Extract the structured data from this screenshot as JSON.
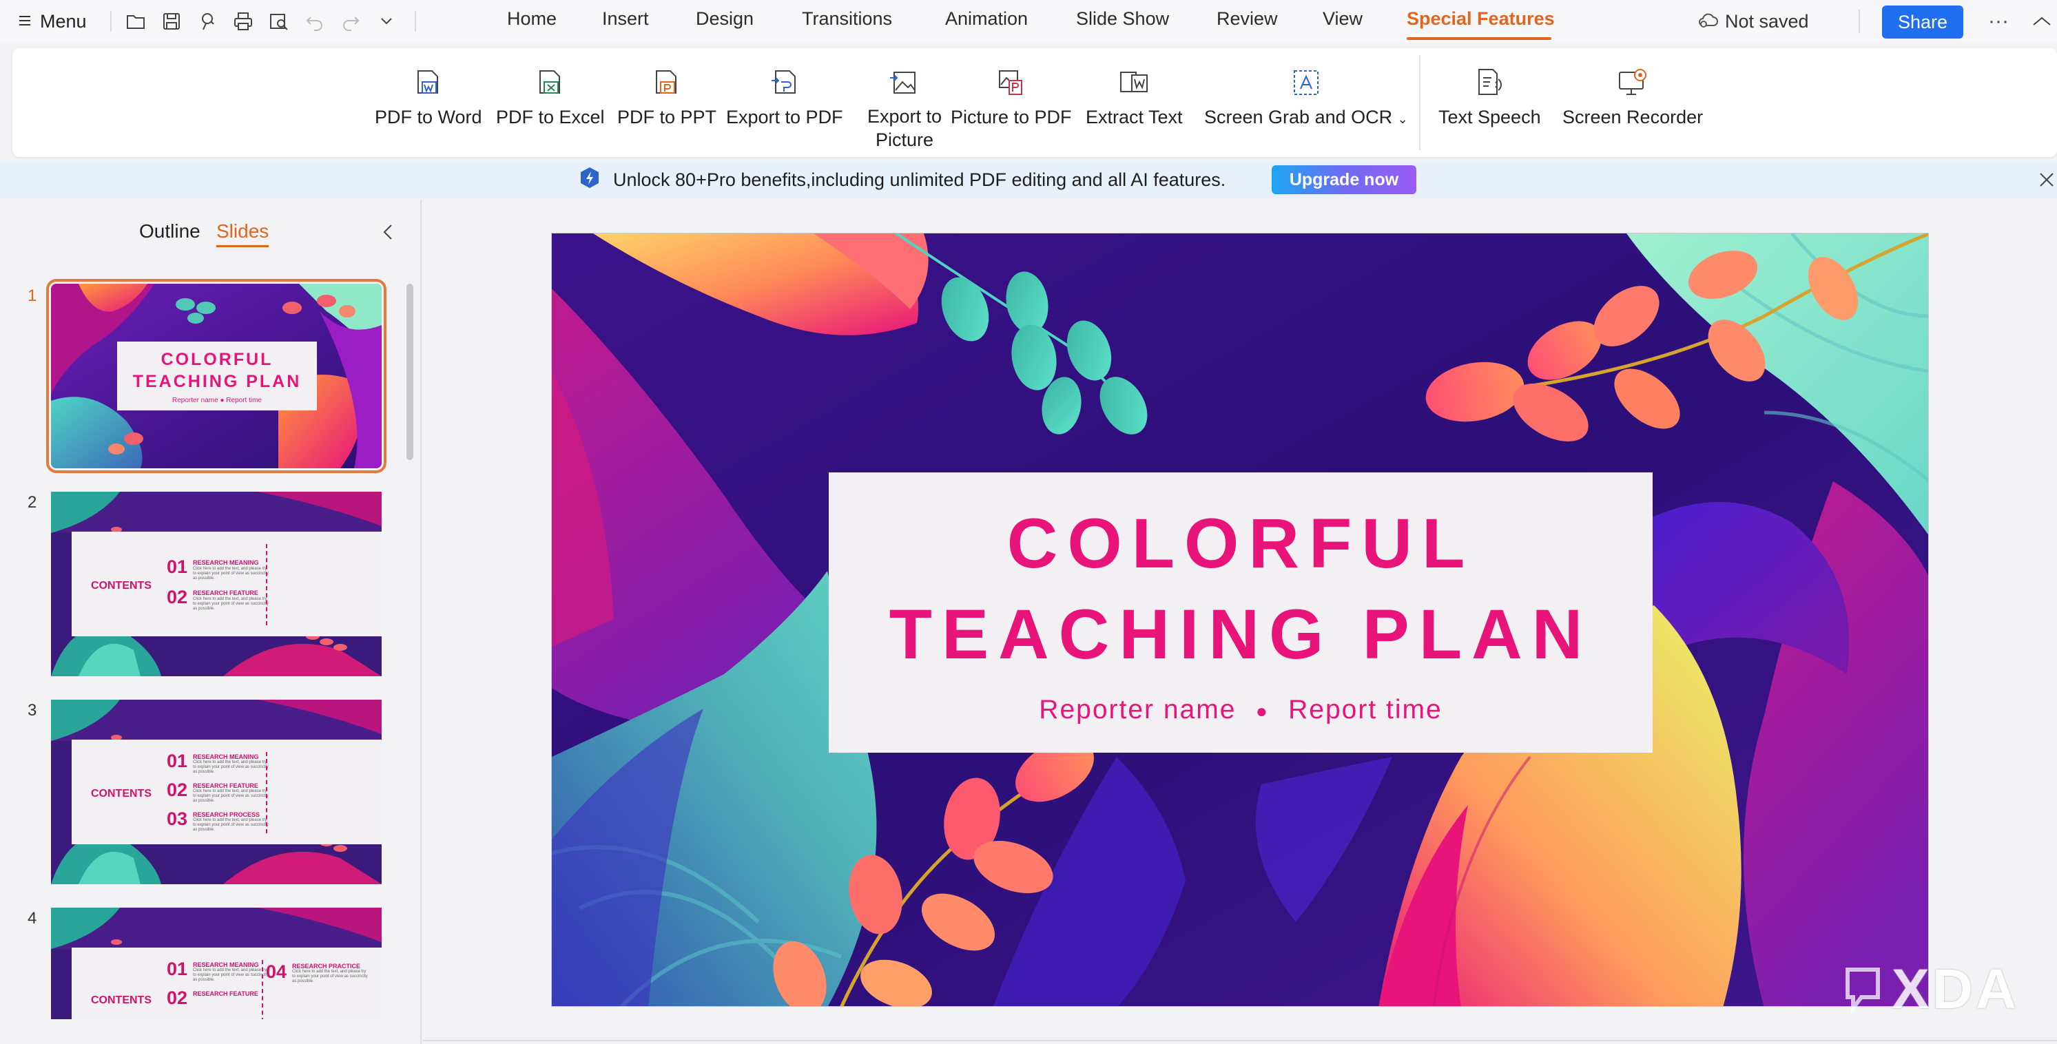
{
  "menubar": {
    "menu_label": "Menu",
    "tabs": [
      "Home",
      "Insert",
      "Design",
      "Transitions",
      "Animation",
      "Slide Show",
      "Review",
      "View",
      "Special Features"
    ],
    "active_tab": "Special Features",
    "save_status": "Not saved",
    "share_label": "Share",
    "more_glyph": "···",
    "accent_color": "#e0661f"
  },
  "ribbon": {
    "pdf_to_word": "PDF to Word",
    "pdf_to_excel": "PDF to Excel",
    "pdf_to_ppt": "PDF to PPT",
    "export_to_pdf": "Export to PDF",
    "export_to_picture": "Export to Picture",
    "picture_to_pdf": "Picture to PDF",
    "extract_text": "Extract Text",
    "screen_grab_ocr": "Screen Grab and OCR",
    "text_speech": "Text Speech",
    "screen_recorder": "Screen Recorder"
  },
  "promo": {
    "text": "Unlock 80+Pro benefits,including unlimited PDF editing and all AI features.",
    "button": "Upgrade now"
  },
  "leftpane": {
    "tab_outline": "Outline",
    "tab_slides": "Slides",
    "active_tab": "Slides",
    "slides": [
      {
        "number": "1",
        "title_line1": "COLORFUL",
        "title_line2": "TEACHING PLAN",
        "sub": "Reporter name   ●   Report time"
      },
      {
        "number": "2",
        "contents": "CONTENTS",
        "items": [
          {
            "num": "01",
            "head": "RESEARCH MEANING"
          },
          {
            "num": "02",
            "head": "RESEARCH FEATURE"
          }
        ]
      },
      {
        "number": "3",
        "contents": "CONTENTS",
        "items": [
          {
            "num": "01",
            "head": "RESEARCH MEANING"
          },
          {
            "num": "02",
            "head": "RESEARCH FEATURE"
          },
          {
            "num": "03",
            "head": "RESEARCH PROCESS"
          }
        ]
      },
      {
        "number": "4",
        "contents": "CONTENTS",
        "items": [
          {
            "num": "01",
            "head": "RESEARCH MEANING"
          },
          {
            "num": "02",
            "head": "RESEARCH FEATURE"
          },
          {
            "num": "04",
            "head": "RESEARCH PRACTICE"
          }
        ]
      }
    ],
    "placeholder_text": "Click here to add the text, and please try to explain your point of view as succinctly as possible."
  },
  "slide": {
    "title_line1": "COLORFUL",
    "title_line2": "TEACHING PLAN",
    "reporter": "Reporter name",
    "bullet": "●",
    "report_time": "Report time",
    "title_color": "#e8147a"
  },
  "watermark": "XDA"
}
